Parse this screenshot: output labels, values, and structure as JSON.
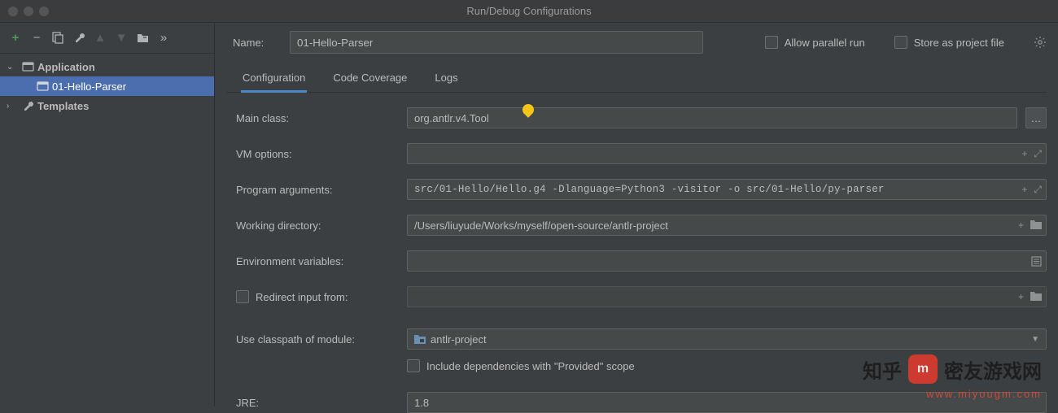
{
  "window": {
    "title": "Run/Debug Configurations"
  },
  "toolbar": {
    "add": "+",
    "remove": "−",
    "copy": "⿻",
    "wrench": "🔧",
    "up": "▲",
    "down": "▼",
    "folder": "📁",
    "more": "»"
  },
  "tree": {
    "application": {
      "label": "Application",
      "child": "01-Hello-Parser"
    },
    "templates": {
      "label": "Templates"
    }
  },
  "header": {
    "name_label": "Name:",
    "name_value": "01-Hello-Parser",
    "allow_parallel": "Allow parallel run",
    "store_project": "Store as project file"
  },
  "tabs": {
    "configuration": "Configuration",
    "coverage": "Code Coverage",
    "logs": "Logs"
  },
  "form": {
    "main_class_label": "Main class:",
    "main_class_value": "org.antlr.v4.Tool",
    "vm_options_label": "VM options:",
    "vm_options_value": "",
    "prog_args_label": "Program arguments:",
    "prog_args_value": "src/01-Hello/Hello.g4 -Dlanguage=Python3 -visitor -o src/01-Hello/py-parser",
    "workdir_label": "Working directory:",
    "workdir_value": "/Users/liuyude/Works/myself/open-source/antlr-project",
    "envvars_label": "Environment variables:",
    "envvars_value": "",
    "redirect_label": "Redirect input from:",
    "redirect_value": "",
    "classpath_label": "Use classpath of module:",
    "classpath_value": "antlr-project",
    "include_provided": "Include dependencies with \"Provided\" scope",
    "jre_label": "JRE:",
    "jre_value": "1.8"
  },
  "watermark": {
    "brand": "知乎",
    "site": "密友游戏网",
    "url": "www.miyougm.com"
  }
}
